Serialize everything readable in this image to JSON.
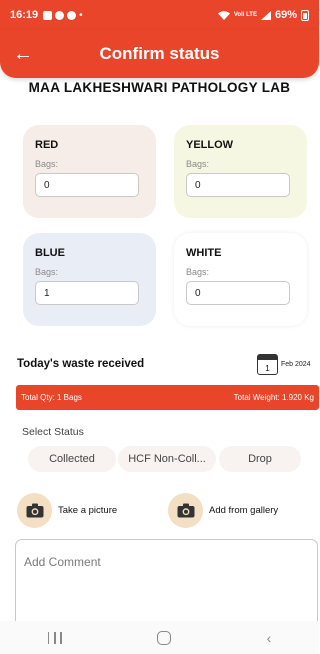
{
  "status_bar": {
    "time": "16:19",
    "dot": "•",
    "network": "Voli LTE",
    "battery": "69%"
  },
  "app_bar": {
    "back_icon": "←",
    "title": "Confirm status"
  },
  "lab_name": "MAA LAKHESHWARI PATHOLOGY LAB",
  "bags": [
    {
      "name": "RED",
      "label": "Bags:",
      "value": "0"
    },
    {
      "name": "YELLOW",
      "label": "Bags:",
      "value": "0"
    },
    {
      "name": "BLUE",
      "label": "Bags:",
      "value": "1"
    },
    {
      "name": "WHITE",
      "label": "Bags:",
      "value": "0"
    }
  ],
  "waste": {
    "title": "Today's waste received",
    "calendar_day": "1",
    "date": "Feb 2024",
    "total_qty": "Total Qty: 1 Bags",
    "total_weight": "Total Weight: 1.920 Kg"
  },
  "status_section": {
    "label": "Select Status",
    "options": [
      "Collected",
      "HCF Non-Coll...",
      "Drop"
    ]
  },
  "photos": {
    "take_picture": "Take a picture",
    "add_gallery": "Add from gallery"
  },
  "comment": {
    "placeholder": "Add Comment"
  },
  "colors": {
    "accent": "#e8452a",
    "camera_circle": "#f3dfc4",
    "red_card": "#f6ece8",
    "yellow_card": "#f6f7e2",
    "blue_card": "#e9eef6"
  }
}
